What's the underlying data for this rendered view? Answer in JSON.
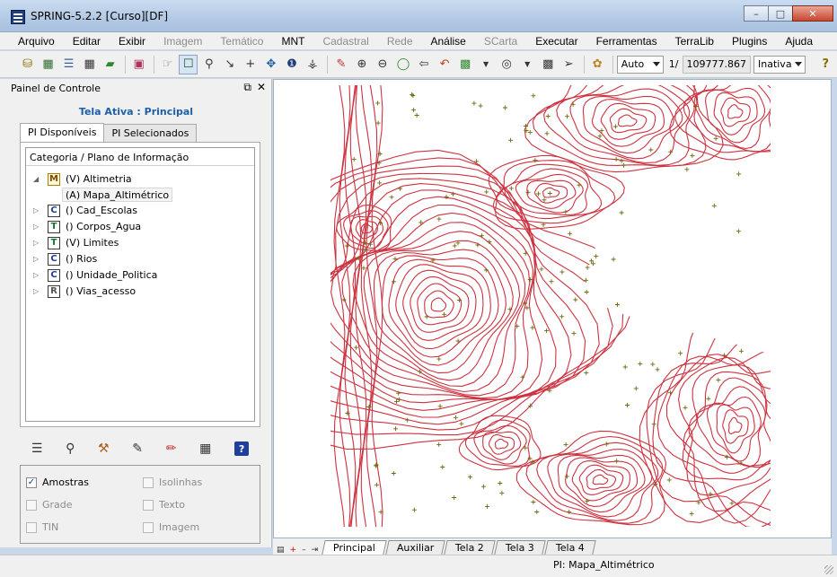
{
  "window": {
    "title": "SPRING-5.2.2 [Curso][DF]"
  },
  "menu": [
    {
      "label": "Arquivo",
      "enabled": true
    },
    {
      "label": "Editar",
      "enabled": true
    },
    {
      "label": "Exibir",
      "enabled": true
    },
    {
      "label": "Imagem",
      "enabled": false
    },
    {
      "label": "Temático",
      "enabled": false
    },
    {
      "label": "MNT",
      "enabled": true
    },
    {
      "label": "Cadastral",
      "enabled": false
    },
    {
      "label": "Rede",
      "enabled": false
    },
    {
      "label": "Análise",
      "enabled": true
    },
    {
      "label": "SCarta",
      "enabled": false
    },
    {
      "label": "Executar",
      "enabled": true
    },
    {
      "label": "Ferramentas",
      "enabled": true
    },
    {
      "label": "TerraLib",
      "enabled": true
    },
    {
      "label": "Plugins",
      "enabled": true
    },
    {
      "label": "Ajuda",
      "enabled": true
    }
  ],
  "toolbar": {
    "auto_select": "Auto",
    "scale_prefix": "1/",
    "scale_value": "109777.867",
    "mode_select": "Inativa"
  },
  "panel": {
    "title": "Painel de Controle",
    "active_screen": "Tela Ativa : Principal",
    "tab_available": "PI Disponíveis",
    "tab_selected": "PI Selecionados",
    "tree_header": "Categoria / Plano de Informação",
    "categories": [
      {
        "letter": "M",
        "label": "(V) Altimetria",
        "expanded": true
      },
      {
        "letter": "C",
        "label": "() Cad_Escolas"
      },
      {
        "letter": "T",
        "label": "() Corpos_Agua"
      },
      {
        "letter": "T",
        "label": "(V) Limites"
      },
      {
        "letter": "C",
        "label": "() Rios"
      },
      {
        "letter": "C",
        "label": "() Unidade_Politica"
      },
      {
        "letter": "R",
        "label": "() Vias_acesso"
      }
    ],
    "pi_item": "(A) Mapa_Altimétrico",
    "visibility": {
      "amostras": {
        "label": "Amostras",
        "checked": true,
        "enabled": true
      },
      "isolinhas": {
        "label": "Isolinhas",
        "checked": false,
        "enabled": false
      },
      "grade": {
        "label": "Grade",
        "checked": false,
        "enabled": false
      },
      "texto": {
        "label": "Texto",
        "checked": false,
        "enabled": false
      },
      "tin": {
        "label": "TIN",
        "checked": false,
        "enabled": false
      },
      "imagem": {
        "label": "Imagem",
        "checked": false,
        "enabled": false
      }
    }
  },
  "view_tabs": [
    "Principal",
    "Auxiliar",
    "Tela 2",
    "Tela 3",
    "Tela 4"
  ],
  "status": {
    "pi": "PI: Mapa_Altimétrico"
  },
  "colors": {
    "contour": "#cc3340",
    "sample": "#6e6a10",
    "accent": "#1f5fa6"
  }
}
